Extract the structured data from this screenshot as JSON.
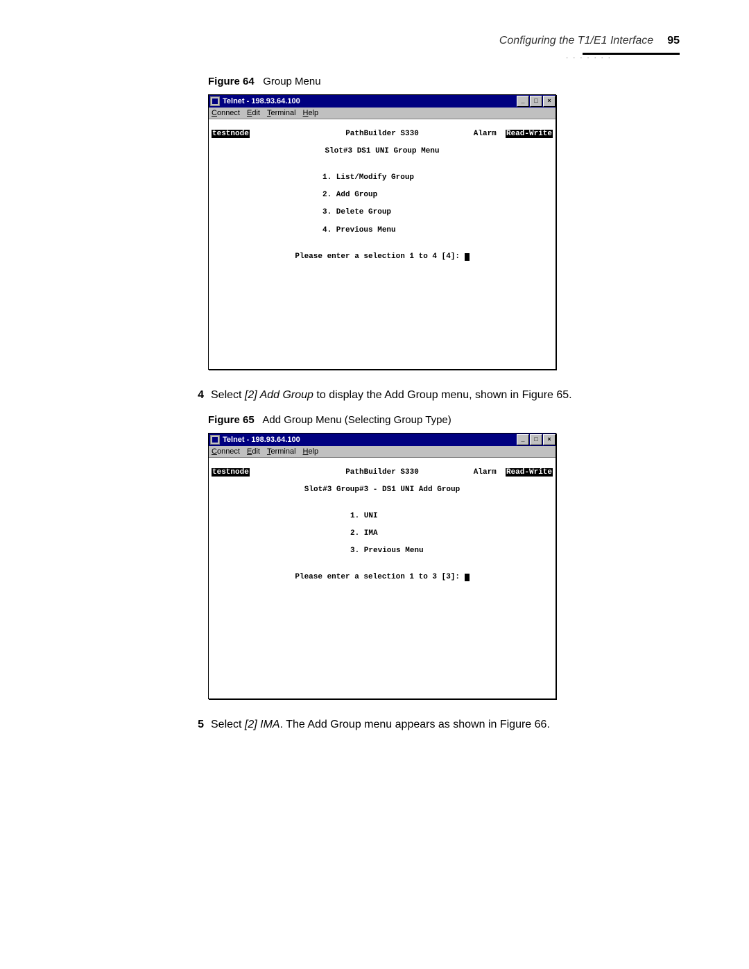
{
  "header": {
    "title": "Configuring the T1/E1 Interface",
    "page_number": "95"
  },
  "figure64": {
    "label": "Figure 64",
    "caption": "Group Menu",
    "window_title": "Telnet - 198.93.64.100",
    "menus": {
      "connect": "Connect",
      "edit": "Edit",
      "terminal": "Terminal",
      "help": "Help"
    },
    "node": "testnode",
    "device": "PathBuilder S330",
    "alarm": "Alarm",
    "mode": "Read-Write",
    "subtitle": "Slot#3 DS1 UNI Group Menu",
    "items": {
      "i1": "1. List/Modify Group",
      "i2": "2. Add Group",
      "i3": "3. Delete Group",
      "i4": "4. Previous Menu"
    },
    "prompt": "Please enter a selection 1 to 4 [4]: "
  },
  "step4": {
    "num": "4",
    "text_pre": "Select ",
    "text_em": "[2] Add Group",
    "text_post": " to display the Add Group menu, shown in Figure 65."
  },
  "figure65": {
    "label": "Figure 65",
    "caption": "Add Group Menu (Selecting Group Type)",
    "window_title": "Telnet - 198.93.64.100",
    "menus": {
      "connect": "Connect",
      "edit": "Edit",
      "terminal": "Terminal",
      "help": "Help"
    },
    "node": "testnode",
    "device": "PathBuilder S330",
    "alarm": "Alarm",
    "mode": "Read-Write",
    "subtitle": "Slot#3 Group#3 - DS1 UNI Add Group",
    "items": {
      "i1": "1. UNI",
      "i2": "2. IMA",
      "i3": "3. Previous Menu"
    },
    "prompt": "Please enter a selection 1 to 3 [3]: "
  },
  "step5": {
    "num": "5",
    "text_pre": "Select ",
    "text_em": "[2] IMA",
    "text_post": ". The Add Group menu appears as shown in Figure 66."
  },
  "win_controls": {
    "min": "_",
    "max": "□",
    "close": "×"
  }
}
